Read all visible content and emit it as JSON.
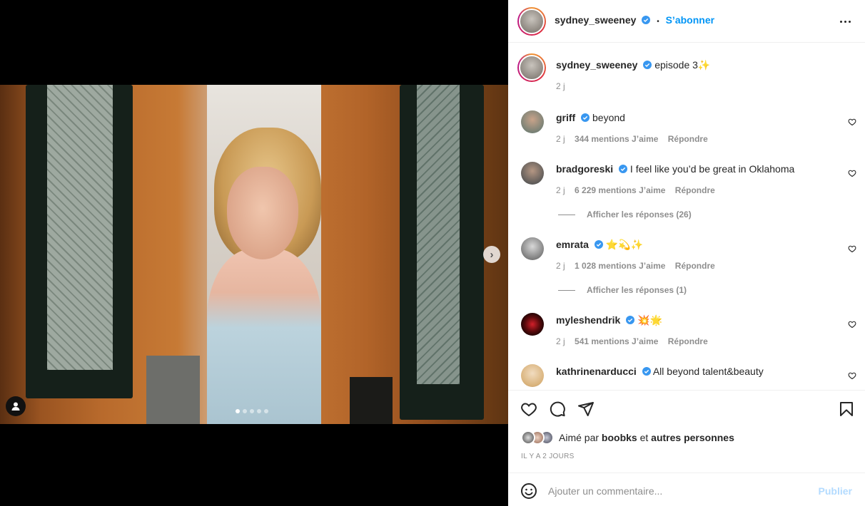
{
  "post": {
    "username": "sydney_sweeney",
    "follow_label": "S’abonner",
    "separator": "•",
    "caption": "episode 3✨",
    "caption_time": "2 j",
    "carousel_dots": 5,
    "carousel_active": 0
  },
  "comments": [
    {
      "username": "griff",
      "text": "beyond",
      "time": "2 j",
      "likes": "344 mentions J’aime",
      "reply_label": "Répondre",
      "avatar_color": "#6e7d73"
    },
    {
      "username": "bradgoreski",
      "text": "I feel like you’d be great in Oklahoma",
      "time": "2 j",
      "likes": "6 229 mentions J’aime",
      "reply_label": "Répondre",
      "avatar_color": "#545454",
      "replies_label": "Afficher les réponses (26)"
    },
    {
      "username": "emrata",
      "text": "⭐💫✨",
      "time": "2 j",
      "likes": "1 028 mentions J’aime",
      "reply_label": "Répondre",
      "avatar_color": "#9a9a9a",
      "replies_label": "Afficher les réponses (1)"
    },
    {
      "username": "myleshendrik",
      "text": "💥🌟",
      "time": "2 j",
      "likes": "541 mentions J’aime",
      "reply_label": "Répondre",
      "avatar_color": "#1a0505"
    },
    {
      "username": "kathrinenarducci",
      "text": "All beyond talent&beauty",
      "avatar_color": "#d9b27a"
    }
  ],
  "likes": {
    "prefix": "Aimé par",
    "user": "boobks",
    "middle": "et",
    "suffix": "autres personnes"
  },
  "time_ago": "IL Y A 2 JOURS",
  "add_comment": {
    "placeholder": "Ajouter un commentaire...",
    "publish_label": "Publier"
  },
  "colors": {
    "accent": "#0095f6",
    "publish_disabled": "#b3dbff",
    "verified": "#3897f0"
  },
  "icons": [
    "chevron-right-icon",
    "user-tag-icon",
    "verified-icon",
    "more-icon",
    "heart-icon",
    "comment-icon",
    "share-icon",
    "bookmark-icon",
    "emoji-icon"
  ]
}
